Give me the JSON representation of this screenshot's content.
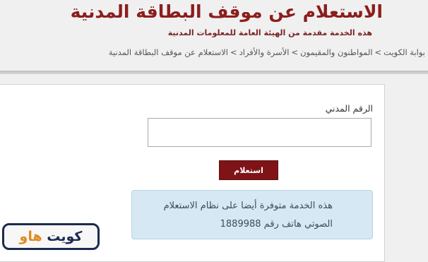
{
  "header": {
    "title": "الاستعلام عن موقف البطاقة المدنية",
    "subtitle": "هذه الخدمة مقدمة من الهيئة العامة للمعلومات المدنية"
  },
  "breadcrumb": {
    "items": [
      "بوابة الكويت",
      "المواطنون والمقيمون",
      "الأسرة والأفراد",
      "الاستعلام عن موقف البطاقة المدنية"
    ],
    "separator": ">"
  },
  "form": {
    "civil_id_label": "الرقم المدني",
    "civil_id_value": "",
    "submit_label": "استعلام"
  },
  "notice": {
    "line1": "هذه الخدمة متوفرة أيضا على نظام الاستعلام",
    "line2": "الصوتي هاتف رقم 1889988"
  },
  "logo": {
    "text_part1": "كويت",
    "text_part2": "هاو"
  },
  "colors": {
    "title": "#8c1d1d",
    "button": "#7e1417",
    "notice_bg": "#d6e8f3",
    "logo_dark": "#1b2a4e",
    "logo_accent": "#e08a1e"
  }
}
